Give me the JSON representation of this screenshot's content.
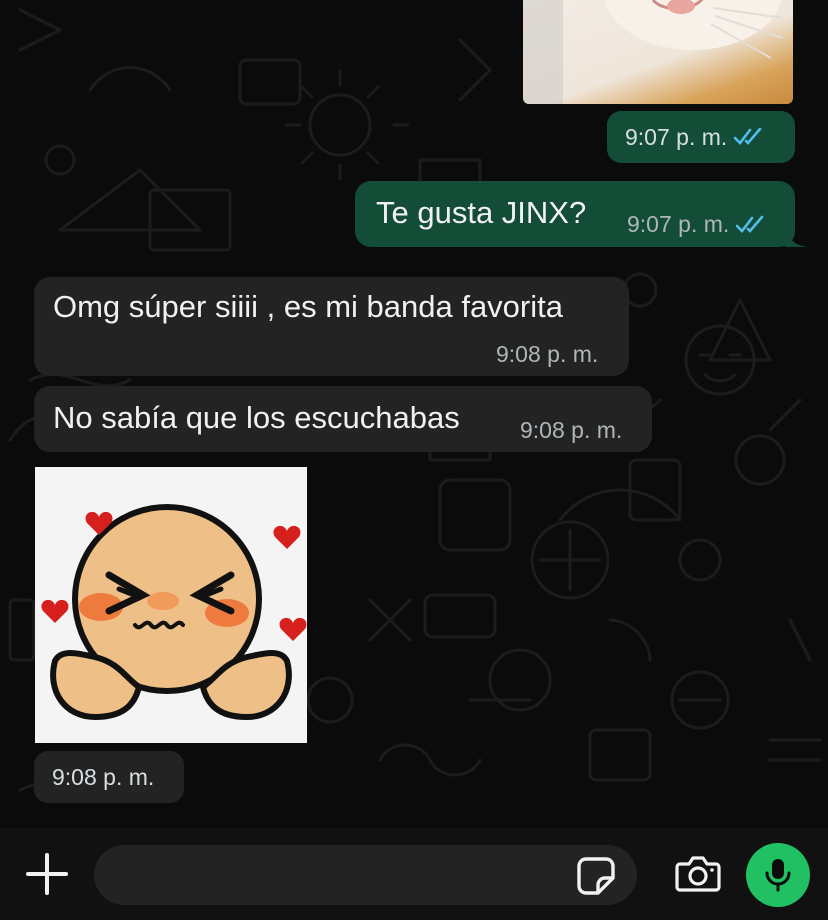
{
  "chat": {
    "image_message": {
      "time": "9:07 p. m.",
      "status": "read",
      "alt": "cat-photo"
    },
    "messages": [
      {
        "direction": "outgoing",
        "text": "Te gusta JINX?",
        "time": "9:07 p. m.",
        "status": "read"
      },
      {
        "direction": "incoming",
        "text": "Omg súper siiii , es mi banda favorita",
        "time": "9:08 p. m."
      },
      {
        "direction": "incoming",
        "text": "No sabía que los escuchabas",
        "time": "9:08 p. m."
      }
    ],
    "sticker_message": {
      "direction": "incoming",
      "time": "9:08 p. m.",
      "description": "blushing-face-sticker"
    }
  },
  "input_bar": {
    "placeholder": "",
    "icons": [
      "plus-icon",
      "sticker-icon",
      "camera-icon",
      "microphone-icon"
    ]
  },
  "colors": {
    "background": "#0b0b0b",
    "outgoing_bubble": "#134d37",
    "incoming_bubble": "#232323",
    "read_ticks": "#53bdeb",
    "mic_button": "#21c063"
  }
}
